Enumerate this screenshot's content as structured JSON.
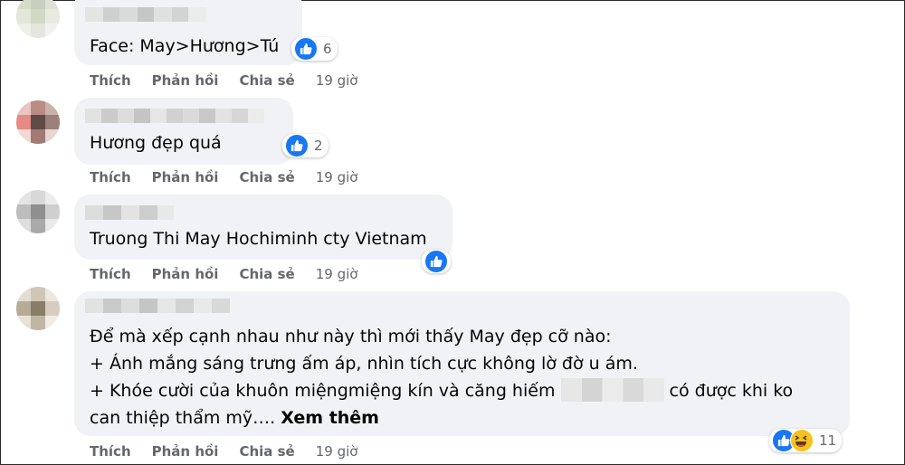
{
  "comments": [
    {
      "text_lines": [
        "Face: May>Hương>Tú"
      ],
      "reactions": {
        "types": [
          "like"
        ],
        "count": "6"
      },
      "actions": {
        "like": "Thích",
        "reply": "Phản hồi",
        "share": "Chia sẻ",
        "time": "19 giờ"
      }
    },
    {
      "text_lines": [
        "Hương đẹp quá"
      ],
      "reactions": {
        "types": [
          "like"
        ],
        "count": "2"
      },
      "actions": {
        "like": "Thích",
        "reply": "Phản hồi",
        "share": "Chia sẻ",
        "time": "19 giờ"
      }
    },
    {
      "text_lines": [
        "Truong Thi May Hochiminh cty Vietnam"
      ],
      "reactions": {
        "types": [
          "like"
        ],
        "count": ""
      },
      "actions": {
        "like": "Thích",
        "reply": "Phản hồi",
        "share": "Chia sẻ",
        "time": "19 giờ"
      }
    },
    {
      "text_lines": [
        "Để mà xếp cạnh nhau như này thì mới thấy May đẹp cỡ nào:",
        "+ Ánh mắng sáng trưng ấm áp, nhìn tích cực không lờ đờ u ám.",
        "+ Khóe cười của khuôn miệngmiệng kín và căng hiếm",
        "có được khi ko",
        "can thiệp thẩm mỹ…. "
      ],
      "see_more": "Xem thêm",
      "reactions": {
        "types": [
          "like",
          "haha"
        ],
        "count": "11"
      },
      "actions": {
        "like": "Thích",
        "reply": "Phản hồi",
        "share": "Chia sẻ",
        "time": "19 giờ"
      }
    }
  ],
  "colors": {
    "bubble": "#f0f2f5",
    "text": "#050505",
    "secondary": "#65676b",
    "like_blue": "#1877f2",
    "haha_yellow": "#f7c21e"
  }
}
